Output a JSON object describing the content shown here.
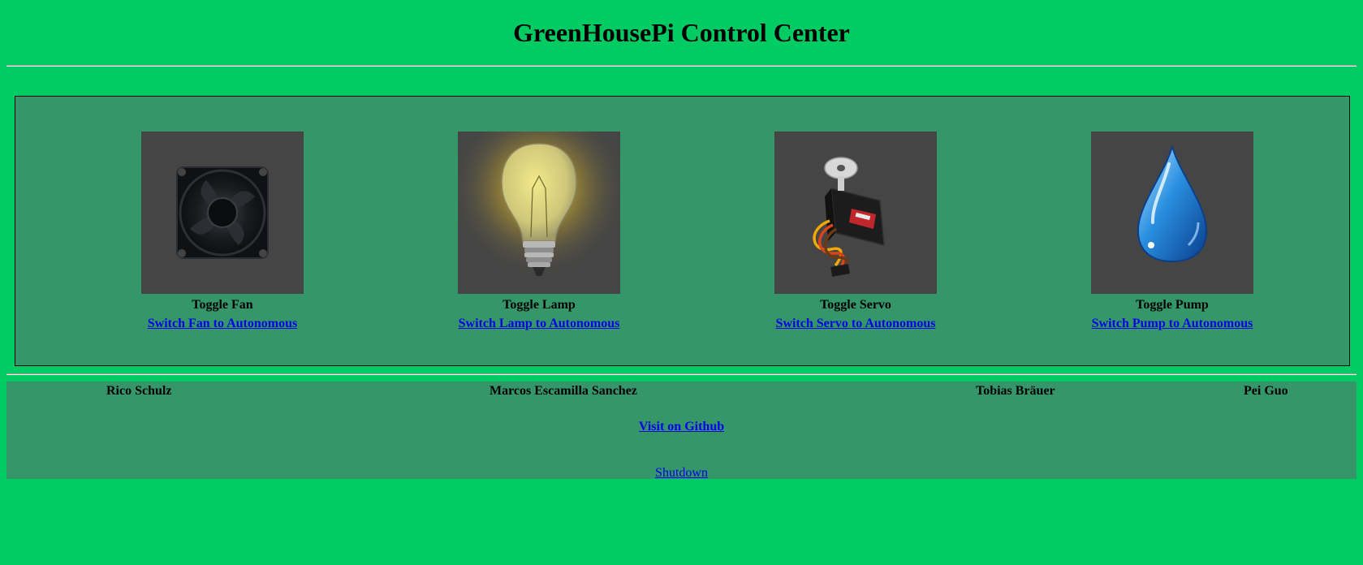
{
  "header": {
    "title": "GreenHousePi Control Center"
  },
  "devices": [
    {
      "toggle_label": "Toggle Fan",
      "auto_label": "Switch Fan to Autonomous",
      "icon": "fan-icon"
    },
    {
      "toggle_label": "Toggle Lamp",
      "auto_label": "Switch Lamp to Autonomous",
      "icon": "lamp-icon"
    },
    {
      "toggle_label": "Toggle Servo",
      "auto_label": "Switch Servo to Autonomous",
      "icon": "servo-icon"
    },
    {
      "toggle_label": "Toggle Pump",
      "auto_label": "Switch Pump to Autonomous",
      "icon": "water-drop-icon"
    }
  ],
  "footer": {
    "authors": [
      "Rico Schulz",
      "Marcos Escamilla Sanchez",
      "Tobias Bräuer",
      "Pei Guo"
    ],
    "github_label": "Visit on Github",
    "shutdown_label": "Shutdown"
  },
  "colors": {
    "page_background": "#00cc63",
    "panel_background": "#35966a",
    "image_background": "#454545",
    "link": "#0000ee"
  }
}
